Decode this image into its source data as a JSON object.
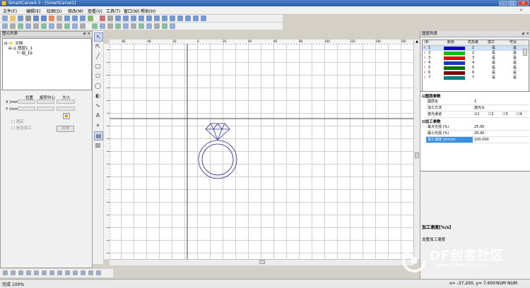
{
  "window": {
    "title": "SmartCarve4.3 - [SmartCarve1]"
  },
  "menu": [
    "文件(F)",
    "编辑(E)",
    "绘图(D)",
    "修改(M)",
    "查看(V)",
    "工具(T)",
    "窗口(W)",
    "帮助(H)"
  ],
  "left_panel": {
    "title": "图元列表",
    "tree": {
      "root": "文档",
      "layer": "图层1_1",
      "group": "组_19"
    }
  },
  "transform": {
    "col_position": "位置",
    "col_rotate_center": "旋转中心",
    "col_size": "大小",
    "x_label": "X (mm)",
    "y_label": "Y (mm)",
    "lock_label": "锁定",
    "proportion_label": "是否加工",
    "apply_label": "应用"
  },
  "layers_panel": {
    "title": "图层列表",
    "headers": [
      "ID",
      "颜色",
      "优先级",
      "加工",
      "可见"
    ],
    "rows": [
      {
        "id": "1",
        "color": "#0000cc",
        "priority": "1",
        "process": "是",
        "visible": "是"
      },
      {
        "id": "2",
        "color": "#00c000",
        "priority": "2",
        "process": "是",
        "visible": "是"
      },
      {
        "id": "3",
        "color": "#e00000",
        "priority": "3",
        "process": "是",
        "visible": "是"
      },
      {
        "id": "4",
        "color": "#2030c0",
        "priority": "4",
        "process": "是",
        "visible": "是"
      },
      {
        "id": "5",
        "color": "#007000",
        "priority": "5",
        "process": "是",
        "visible": "是"
      },
      {
        "id": "6",
        "color": "#800000",
        "priority": "6",
        "process": "是",
        "visible": "是"
      },
      {
        "id": "7",
        "color": "#008080",
        "priority": "7",
        "process": "是",
        "visible": "是"
      }
    ]
  },
  "layer_params": {
    "section": "图层参数",
    "name_label": "图层名",
    "name_value": "1",
    "method_label": "加工方法",
    "method_value": "激光头",
    "channel_label": "激光通道",
    "channel_values": [
      "1",
      "2",
      "3",
      "4"
    ]
  },
  "process_params": {
    "section": "加工参数",
    "max_power_label": "最大光强 (%)",
    "max_power_value": "25.00",
    "min_power_label": "最小光强 (%)",
    "min_power_value": "20.00",
    "speed_label": "加工速度 (mm/s)",
    "speed_value": "100.000"
  },
  "help": {
    "title": "加工速度[%/s]",
    "desc": "设置加工速度"
  },
  "ruler_labels": [
    "-60",
    "-40",
    "-20",
    "0",
    "20",
    "40",
    "60",
    "80",
    "100",
    "120",
    "140",
    "160",
    "180"
  ],
  "status": {
    "zoom": "完成 100%",
    "coords": "x= -37.200, y= 7.600",
    "mode": "NUM NUM"
  },
  "watermark": {
    "brand": "DF创客社区",
    "url": "www.DFRobot.com.cn"
  }
}
